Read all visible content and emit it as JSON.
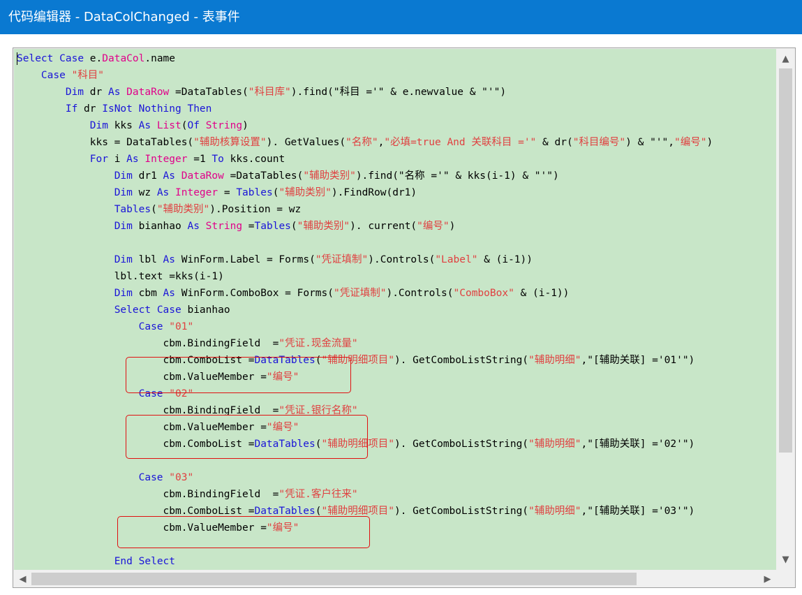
{
  "window": {
    "title": "代码编辑器 - DataColChanged - 表事件"
  },
  "colors": {
    "titlebar": "#0a79d1",
    "editor_background": "#c8e6c8",
    "keyword": "#1a14d8",
    "type": "#e0008a",
    "string": "#e04040",
    "highlight_box": "#e01010"
  },
  "icons": {
    "scroll_up": "▲",
    "scroll_down": "▼",
    "scroll_left": "◀",
    "scroll_right": "▶"
  },
  "code_lines": [
    [
      [
        "kw",
        "Select"
      ],
      [
        "t",
        " "
      ],
      [
        "kw",
        "Case"
      ],
      [
        "t",
        " e."
      ],
      [
        "ty",
        "DataCol"
      ],
      [
        "t",
        ".name"
      ]
    ],
    [
      [
        "t",
        "    "
      ],
      [
        "kw",
        "Case"
      ],
      [
        "t",
        " "
      ],
      [
        "st",
        "\"科目\""
      ]
    ],
    [
      [
        "t",
        "        "
      ],
      [
        "kw",
        "Dim"
      ],
      [
        "t",
        " dr "
      ],
      [
        "kw",
        "As"
      ],
      [
        "t",
        " "
      ],
      [
        "ty",
        "DataRow"
      ],
      [
        "t",
        " =DataTables("
      ],
      [
        "st",
        "\"科目库\""
      ],
      [
        "t",
        ").find(\"科目 ='\" & e.newvalue & \"'\")"
      ]
    ],
    [
      [
        "t",
        "        "
      ],
      [
        "kw",
        "If"
      ],
      [
        "t",
        " dr "
      ],
      [
        "kw",
        "IsNot"
      ],
      [
        "t",
        " "
      ],
      [
        "kw",
        "Nothing"
      ],
      [
        "t",
        " "
      ],
      [
        "kw",
        "Then"
      ]
    ],
    [
      [
        "t",
        "            "
      ],
      [
        "kw",
        "Dim"
      ],
      [
        "t",
        " kks "
      ],
      [
        "kw",
        "As"
      ],
      [
        "t",
        " "
      ],
      [
        "ty",
        "List"
      ],
      [
        "t",
        "("
      ],
      [
        "kw",
        "Of"
      ],
      [
        "t",
        " "
      ],
      [
        "ty",
        "String"
      ],
      [
        "t",
        ")"
      ]
    ],
    [
      [
        "t",
        "            kks = DataTables("
      ],
      [
        "st",
        "\"辅助核算设置\""
      ],
      [
        "t",
        "). GetValues("
      ],
      [
        "st",
        "\"名称\""
      ],
      [
        "t",
        ","
      ],
      [
        "st",
        "\"必填=true And 关联科目 ='\""
      ],
      [
        "t",
        " & dr("
      ],
      [
        "st",
        "\"科目编号\""
      ],
      [
        "t",
        ") & \"'\","
      ],
      [
        "st",
        "\"编号\""
      ],
      [
        "t",
        ")"
      ]
    ],
    [
      [
        "t",
        "            "
      ],
      [
        "kw",
        "For"
      ],
      [
        "t",
        " i "
      ],
      [
        "kw",
        "As"
      ],
      [
        "t",
        " "
      ],
      [
        "ty",
        "Integer"
      ],
      [
        "t",
        " =1 "
      ],
      [
        "kw",
        "To"
      ],
      [
        "t",
        " kks.count"
      ]
    ],
    [
      [
        "t",
        "                "
      ],
      [
        "kw",
        "Dim"
      ],
      [
        "t",
        " dr1 "
      ],
      [
        "kw",
        "As"
      ],
      [
        "t",
        " "
      ],
      [
        "ty",
        "DataRow"
      ],
      [
        "t",
        " =DataTables("
      ],
      [
        "st",
        "\"辅助类别\""
      ],
      [
        "t",
        ").find(\"名称 ='\" & kks(i-1) & \"'\")"
      ]
    ],
    [
      [
        "t",
        "                "
      ],
      [
        "kw",
        "Dim"
      ],
      [
        "t",
        " wz "
      ],
      [
        "kw",
        "As"
      ],
      [
        "t",
        " "
      ],
      [
        "ty",
        "Integer"
      ],
      [
        "t",
        " = "
      ],
      [
        "kw",
        "Tables"
      ],
      [
        "t",
        "("
      ],
      [
        "st",
        "\"辅助类别\""
      ],
      [
        "t",
        ").FindRow(dr1)"
      ]
    ],
    [
      [
        "t",
        "                "
      ],
      [
        "kw",
        "Tables"
      ],
      [
        "t",
        "("
      ],
      [
        "st",
        "\"辅助类别\""
      ],
      [
        "t",
        ").Position = wz"
      ]
    ],
    [
      [
        "t",
        "                "
      ],
      [
        "kw",
        "Dim"
      ],
      [
        "t",
        " bianhao "
      ],
      [
        "kw",
        "As"
      ],
      [
        "t",
        " "
      ],
      [
        "ty",
        "String"
      ],
      [
        "t",
        " ="
      ],
      [
        "kw",
        "Tables"
      ],
      [
        "t",
        "("
      ],
      [
        "st",
        "\"辅助类别\""
      ],
      [
        "t",
        "). current("
      ],
      [
        "st",
        "\"编号\""
      ],
      [
        "t",
        ")"
      ]
    ],
    [
      [
        "t",
        ""
      ]
    ],
    [
      [
        "t",
        "                "
      ],
      [
        "kw",
        "Dim"
      ],
      [
        "t",
        " lbl "
      ],
      [
        "kw",
        "As"
      ],
      [
        "t",
        " WinForm.Label = Forms("
      ],
      [
        "st",
        "\"凭证填制\""
      ],
      [
        "t",
        ").Controls("
      ],
      [
        "st",
        "\"Label\""
      ],
      [
        "t",
        " & (i-1))"
      ]
    ],
    [
      [
        "t",
        "                lbl.text =kks(i-1)"
      ]
    ],
    [
      [
        "t",
        "                "
      ],
      [
        "kw",
        "Dim"
      ],
      [
        "t",
        " cbm "
      ],
      [
        "kw",
        "As"
      ],
      [
        "t",
        " WinForm.ComboBox = Forms("
      ],
      [
        "st",
        "\"凭证填制\""
      ],
      [
        "t",
        ").Controls("
      ],
      [
        "st",
        "\"ComboBox\""
      ],
      [
        "t",
        " & (i-1))"
      ]
    ],
    [
      [
        "t",
        "                "
      ],
      [
        "kw",
        "Select"
      ],
      [
        "t",
        " "
      ],
      [
        "kw",
        "Case"
      ],
      [
        "t",
        " bianhao"
      ]
    ],
    [
      [
        "t",
        "                    "
      ],
      [
        "kw",
        "Case"
      ],
      [
        "t",
        " "
      ],
      [
        "st",
        "\"01\""
      ]
    ],
    [
      [
        "t",
        "                        cbm.BindingField  ="
      ],
      [
        "st",
        "\"凭证.现金流量\""
      ]
    ],
    [
      [
        "t",
        "                        cbm.ComboList ="
      ],
      [
        "kw",
        "DataTables"
      ],
      [
        "t",
        "("
      ],
      [
        "st",
        "\"辅助明细项目\""
      ],
      [
        "t",
        "). GetComboListString("
      ],
      [
        "st",
        "\"辅助明细\""
      ],
      [
        "t",
        ",\"[辅助关联] ='01'\")"
      ]
    ],
    [
      [
        "t",
        "                        cbm.ValueMember ="
      ],
      [
        "st",
        "\"编号\""
      ]
    ],
    [
      [
        "t",
        "                    "
      ],
      [
        "kw",
        "Case"
      ],
      [
        "t",
        " "
      ],
      [
        "st",
        "\"02\""
      ]
    ],
    [
      [
        "t",
        "                        cbm.BindingField  ="
      ],
      [
        "st",
        "\"凭证.银行名称\""
      ]
    ],
    [
      [
        "t",
        "                        cbm.ValueMember ="
      ],
      [
        "st",
        "\"编号\""
      ]
    ],
    [
      [
        "t",
        "                        cbm.ComboList ="
      ],
      [
        "kw",
        "DataTables"
      ],
      [
        "t",
        "("
      ],
      [
        "st",
        "\"辅助明细项目\""
      ],
      [
        "t",
        "). GetComboListString("
      ],
      [
        "st",
        "\"辅助明细\""
      ],
      [
        "t",
        ",\"[辅助关联] ='02'\")"
      ]
    ],
    [
      [
        "t",
        ""
      ]
    ],
    [
      [
        "t",
        "                    "
      ],
      [
        "kw",
        "Case"
      ],
      [
        "t",
        " "
      ],
      [
        "st",
        "\"03\""
      ]
    ],
    [
      [
        "t",
        "                        cbm.BindingField  ="
      ],
      [
        "st",
        "\"凭证.客户往来\""
      ]
    ],
    [
      [
        "t",
        "                        cbm.ComboList ="
      ],
      [
        "kw",
        "DataTables"
      ],
      [
        "t",
        "("
      ],
      [
        "st",
        "\"辅助明细项目\""
      ],
      [
        "t",
        "). GetComboListString("
      ],
      [
        "st",
        "\"辅助明细\""
      ],
      [
        "t",
        ",\"[辅助关联] ='03'\")"
      ]
    ],
    [
      [
        "t",
        "                        cbm.ValueMember ="
      ],
      [
        "st",
        "\"编号\""
      ]
    ],
    [
      [
        "t",
        ""
      ]
    ],
    [
      [
        "t",
        "                "
      ],
      [
        "kw",
        "End"
      ],
      [
        "t",
        " "
      ],
      [
        "kw",
        "Select"
      ]
    ]
  ]
}
